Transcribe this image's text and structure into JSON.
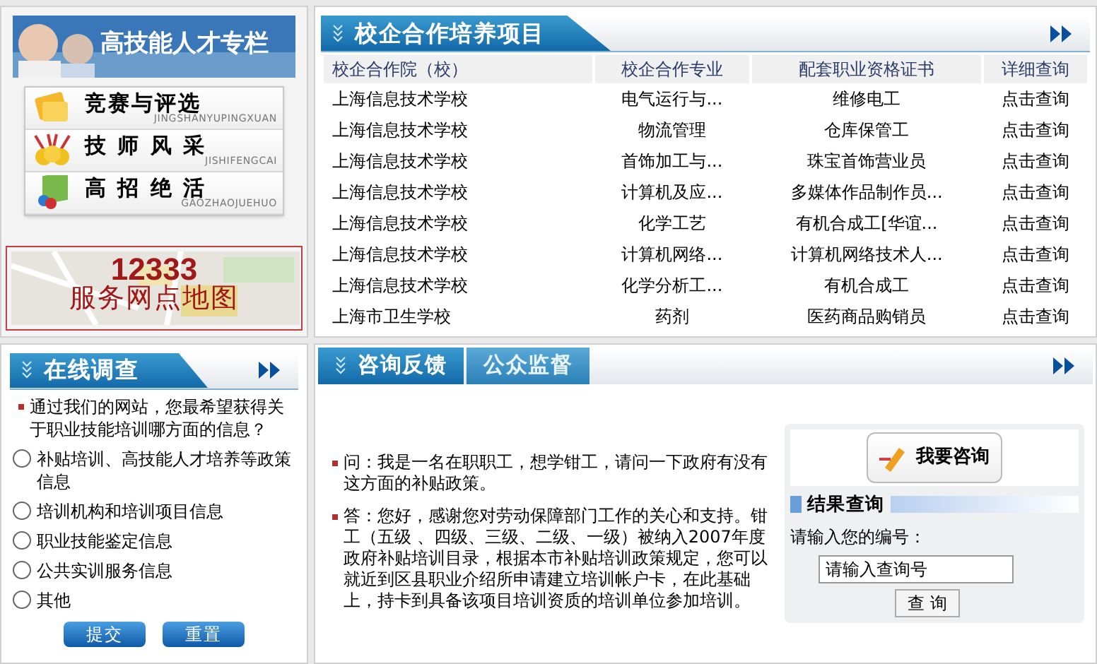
{
  "sidebar": {
    "banner": {
      "title": "高技能人才专栏"
    },
    "menu": [
      {
        "label": "竞赛与评选",
        "pinyin": "JINGSHANYUPINGXUAN",
        "kind": "trophy"
      },
      {
        "label": "技 师 风 采",
        "pinyin": "JISHIFENGCAI",
        "kind": "medal"
      },
      {
        "label": "高 招 绝 活",
        "pinyin": "GAOZHAOJUEHUO",
        "kind": "book"
      }
    ],
    "map_banner": {
      "number": "12333",
      "title": "服务网点地图"
    }
  },
  "projects": {
    "title": "校企合作培养项目",
    "columns": [
      "校企合作院（校）",
      "校企合作专业",
      "配套职业资格证书",
      "详细查询"
    ],
    "rows": [
      [
        "上海信息技术学校",
        "电气运行与...",
        "维修电工",
        "点击查询"
      ],
      [
        "上海信息技术学校",
        "物流管理",
        "仓库保管工",
        "点击查询"
      ],
      [
        "上海信息技术学校",
        "首饰加工与...",
        "珠宝首饰营业员",
        "点击查询"
      ],
      [
        "上海信息技术学校",
        "计算机及应...",
        "多媒体作品制作员...",
        "点击查询"
      ],
      [
        "上海信息技术学校",
        "化学工艺",
        "有机合成工[华谊...",
        "点击查询"
      ],
      [
        "上海信息技术学校",
        "计算机网络...",
        "计算机网络技术人...",
        "点击查询"
      ],
      [
        "上海信息技术学校",
        "化学分析工...",
        "有机合成工",
        "点击查询"
      ],
      [
        "上海市卫生学校",
        "药剂",
        "医药商品购销员",
        "点击查询"
      ]
    ]
  },
  "survey": {
    "title": "在线调查",
    "question": "通过我们的网站，您最希望获得关于职业技能培训哪方面的信息？",
    "options": [
      {
        "label": "补贴培训、高技能人才培养等政策信息",
        "selected": false
      },
      {
        "label": "培训机构和培训项目信息",
        "selected": false
      },
      {
        "label": "职业技能鉴定信息",
        "selected": false
      },
      {
        "label": "公共实训服务信息",
        "selected": false
      },
      {
        "label": "其他",
        "selected": false
      }
    ],
    "buttons": [
      "提交",
      "重置"
    ]
  },
  "consult": {
    "tabs": [
      {
        "label": "咨询反馈",
        "selected": true
      },
      {
        "label": "公众监督",
        "selected": false
      }
    ],
    "question": "问：我是一名在职职工，想学钳工，请问一下政府有没有这方面的补贴政策。",
    "answer": "答：您好，感谢您对劳动保障部门工作的关心和支持。钳工（五级 、四级、三级、二级、一级）被纳入2007年度政府补贴培训目录，根据本市补贴培训政策规定，您可以就近到区县职业介绍所申请建立培训帐户卡，在此基础上，持卡到具备该项目培训资质的培训单位参加培训。",
    "ask_button": "我要咨询",
    "result_title": "结果查询",
    "id_label": "请输入您的编号：",
    "id_value": "请输入查询号",
    "search_button": "查 询"
  }
}
